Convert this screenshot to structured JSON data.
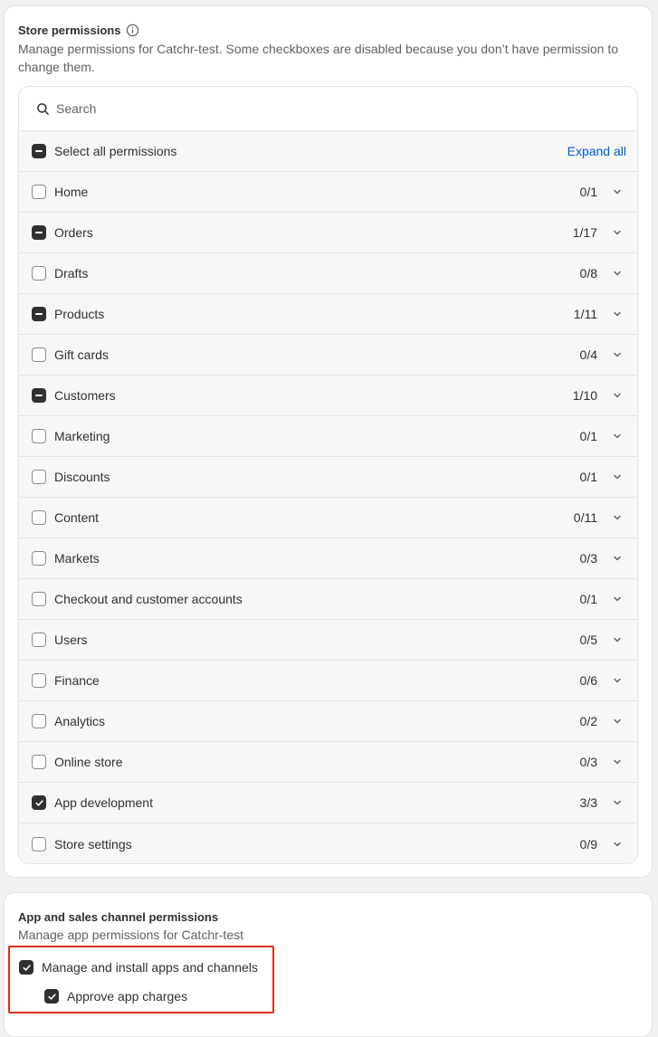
{
  "store_permissions": {
    "title": "Store permissions",
    "description": "Manage permissions for Catchr-test. Some checkboxes are disabled because you don’t have permission to change them.",
    "search_placeholder": "Search",
    "select_all_label": "Select all permissions",
    "expand_all_label": "Expand all",
    "items": [
      {
        "label": "Home",
        "count": "0/1",
        "state": "unchecked"
      },
      {
        "label": "Orders",
        "count": "1/17",
        "state": "mixed"
      },
      {
        "label": "Drafts",
        "count": "0/8",
        "state": "unchecked"
      },
      {
        "label": "Products",
        "count": "1/11",
        "state": "mixed"
      },
      {
        "label": "Gift cards",
        "count": "0/4",
        "state": "unchecked"
      },
      {
        "label": "Customers",
        "count": "1/10",
        "state": "mixed"
      },
      {
        "label": "Marketing",
        "count": "0/1",
        "state": "unchecked"
      },
      {
        "label": "Discounts",
        "count": "0/1",
        "state": "unchecked"
      },
      {
        "label": "Content",
        "count": "0/11",
        "state": "unchecked"
      },
      {
        "label": "Markets",
        "count": "0/3",
        "state": "unchecked"
      },
      {
        "label": "Checkout and customer accounts",
        "count": "0/1",
        "state": "unchecked"
      },
      {
        "label": "Users",
        "count": "0/5",
        "state": "unchecked"
      },
      {
        "label": "Finance",
        "count": "0/6",
        "state": "unchecked"
      },
      {
        "label": "Analytics",
        "count": "0/2",
        "state": "unchecked"
      },
      {
        "label": "Online store",
        "count": "0/3",
        "state": "unchecked"
      },
      {
        "label": "App development",
        "count": "3/3",
        "state": "checked"
      },
      {
        "label": "Store settings",
        "count": "0/9",
        "state": "unchecked"
      }
    ]
  },
  "app_permissions": {
    "title": "App and sales channel permissions",
    "description": "Manage app permissions for Catchr-test",
    "manage_label": "Manage and install apps and channels",
    "approve_label": "Approve app charges"
  },
  "colors": {
    "accent": "#005bd3",
    "checked": "#303030",
    "highlight": "#e32c12"
  }
}
